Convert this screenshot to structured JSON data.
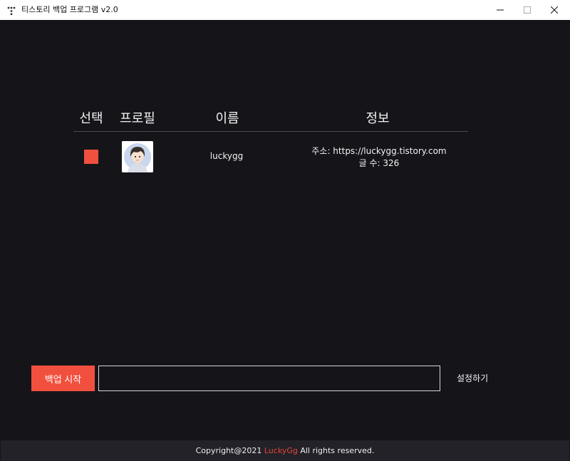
{
  "window": {
    "title": "티스토리 백업 프로그램 v2.0",
    "icon": "tistory-logo-icon"
  },
  "table": {
    "headers": {
      "select": "선택",
      "profile": "프로필",
      "name": "이름",
      "info": "정보"
    },
    "rows": [
      {
        "selected": true,
        "name": "luckygg",
        "address": "주소: https://luckygg.tistory.com",
        "post_count": "글 수: 326"
      }
    ]
  },
  "controls": {
    "backup_label": "백업 시작",
    "path_value": "",
    "settings_label": "설정하기"
  },
  "footer": {
    "prefix": "Copyright@2021 ",
    "brand": "LuckyGg",
    "suffix": " All rights reserved."
  },
  "colors": {
    "accent": "#f2503f",
    "background": "#151419",
    "footer_bg": "#222228"
  }
}
